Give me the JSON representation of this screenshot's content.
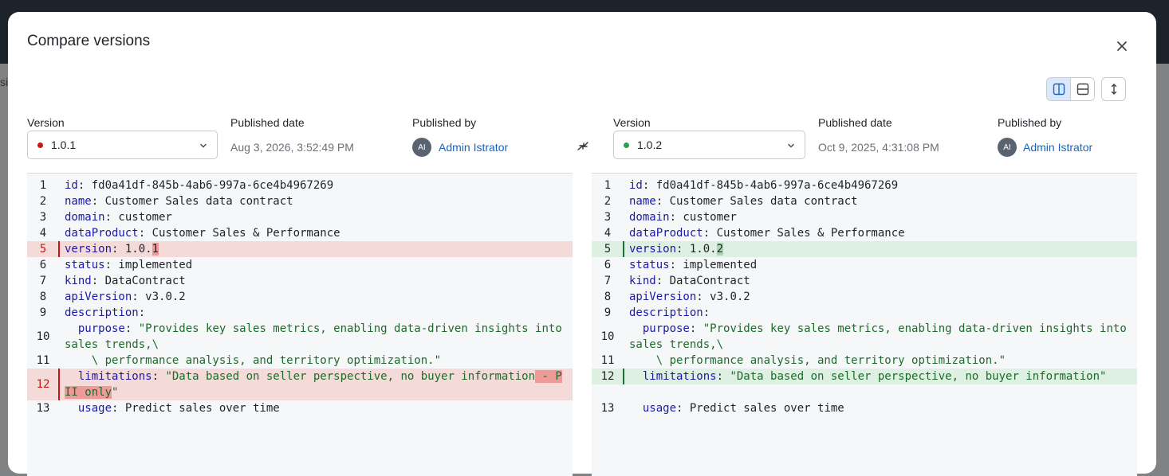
{
  "background": {
    "partial_text": "si"
  },
  "modal": {
    "title": "Compare versions",
    "close_icon": "close-icon",
    "view_modes": [
      "split-view-icon",
      "unified-view-icon",
      "expand-icon"
    ]
  },
  "left": {
    "version_label": "Version",
    "version_value": "1.0.1",
    "version_dot_color": "#c21818",
    "published_date_label": "Published date",
    "published_date": "Aug 3, 2026, 3:52:49 PM",
    "published_by_label": "Published by",
    "avatar": "AI",
    "user": "Admin Istrator"
  },
  "right": {
    "version_label": "Version",
    "version_value": "1.0.2",
    "version_dot_color": "#2e9e4a",
    "published_date_label": "Published date",
    "published_date": "Oct 9, 2025, 4:31:08 PM",
    "published_by_label": "Published by",
    "avatar": "AI",
    "user": "Admin Istrator"
  },
  "diff": {
    "left_lines": [
      {
        "n": "1",
        "key": "id",
        "rest": ": fd0a41df-845b-4ab6-997a-6ce4b4967269"
      },
      {
        "n": "2",
        "key": "name",
        "rest": ": Customer Sales data contract"
      },
      {
        "n": "3",
        "key": "domain",
        "rest": ": customer"
      },
      {
        "n": "4",
        "key": "dataProduct",
        "rest": ": Customer Sales & Performance"
      },
      {
        "n": "5",
        "key": "version",
        "rest": ": 1.0.",
        "hl": "1",
        "type": "del"
      },
      {
        "n": "6",
        "key": "status",
        "rest": ": implemented"
      },
      {
        "n": "7",
        "key": "kind",
        "rest": ": DataContract"
      },
      {
        "n": "8",
        "key": "apiVersion",
        "rest": ": v3.0.2"
      },
      {
        "n": "9",
        "key": "description",
        "rest": ":"
      },
      {
        "n": "10",
        "indent": "  ",
        "key": "purpose",
        "rest": ": ",
        "str": "\"Provides key sales metrics, enabling data-driven insights into sales trends,\\"
      },
      {
        "n": "11",
        "indent": "    ",
        "str": "\\ performance analysis, and territory optimization.\""
      },
      {
        "n": "12",
        "indent": "  ",
        "key": "limitations",
        "rest": ": ",
        "str": "\"Data based on seller perspective, no buyer information",
        "hl": " - PII only",
        "str2": "\"",
        "type": "del"
      },
      {
        "n": "13",
        "indent": "  ",
        "key": "usage",
        "rest": ": Predict sales over time"
      }
    ],
    "right_lines": [
      {
        "n": "1",
        "key": "id",
        "rest": ": fd0a41df-845b-4ab6-997a-6ce4b4967269"
      },
      {
        "n": "2",
        "key": "name",
        "rest": ": Customer Sales data contract"
      },
      {
        "n": "3",
        "key": "domain",
        "rest": ": customer"
      },
      {
        "n": "4",
        "key": "dataProduct",
        "rest": ": Customer Sales & Performance"
      },
      {
        "n": "5",
        "key": "version",
        "rest": ": 1.0.",
        "hl": "2",
        "type": "add"
      },
      {
        "n": "6",
        "key": "status",
        "rest": ": implemented"
      },
      {
        "n": "7",
        "key": "kind",
        "rest": ": DataContract"
      },
      {
        "n": "8",
        "key": "apiVersion",
        "rest": ": v3.0.2"
      },
      {
        "n": "9",
        "key": "description",
        "rest": ":"
      },
      {
        "n": "10",
        "indent": "  ",
        "key": "purpose",
        "rest": ": ",
        "str": "\"Provides key sales metrics, enabling data-driven insights into sales trends,\\"
      },
      {
        "n": "11",
        "indent": "    ",
        "str": "\\ performance analysis, and territory optimization.\""
      },
      {
        "n": "12",
        "indent": "  ",
        "key": "limitations",
        "rest": ": ",
        "str": "\"Data based on seller perspective, no buyer information\"",
        "type": "add",
        "pad_after": true
      },
      {
        "n": "13",
        "indent": "  ",
        "key": "usage",
        "rest": ": Predict sales over time"
      }
    ]
  }
}
